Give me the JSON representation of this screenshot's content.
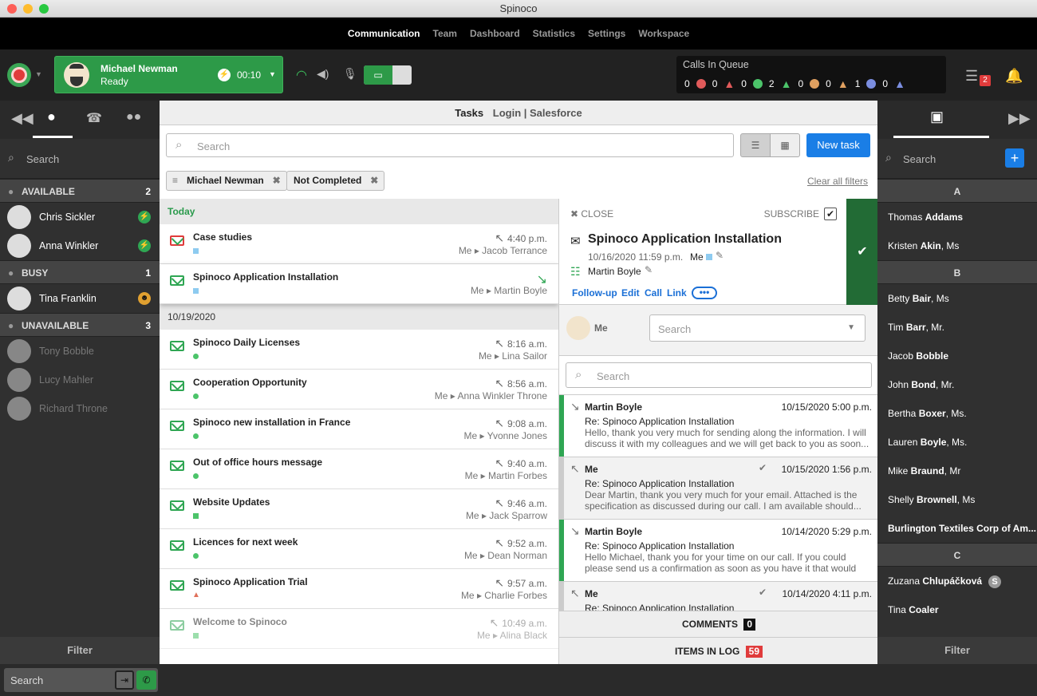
{
  "window": {
    "title": "Spinoco"
  },
  "nav": {
    "items": [
      "Communication",
      "Team",
      "Dashboard",
      "Statistics",
      "Settings",
      "Workspace"
    ],
    "active": 0
  },
  "agent": {
    "name": "Michael Newman",
    "status": "Ready",
    "timer": "00:10"
  },
  "queue": {
    "title": "Calls In Queue",
    "counts": [
      "0",
      "0",
      "0",
      "2",
      "0",
      "0",
      "1",
      "0"
    ]
  },
  "notifications": {
    "task_count": "2"
  },
  "left": {
    "search": "Search",
    "groups": [
      {
        "label": "AVAILABLE",
        "count": "2",
        "people": [
          "Chris Sickler",
          "Anna Winkler"
        ]
      },
      {
        "label": "BUSY",
        "count": "1",
        "people": [
          "Tina Franklin"
        ]
      },
      {
        "label": "UNAVAILABLE",
        "count": "3",
        "people": [
          "Tony Bobble",
          "Lucy Mahler",
          "Richard Throne"
        ]
      }
    ],
    "filter": "Filter"
  },
  "center": {
    "header_title": "Tasks",
    "header_link": "Login | Salesforce",
    "search_placeholder": "Search",
    "new_task": "New task",
    "filter_chip_1": "Michael Newman",
    "filter_chip_2": "Not Completed",
    "clear_filters": "Clear all filters"
  },
  "tasks": {
    "today_label": "Today",
    "today": [
      {
        "title": "Case studies",
        "time": "4:40 p.m.",
        "who": "Me ▸ Jacob Terrance"
      },
      {
        "title": "Spinoco Application Installation",
        "time": "",
        "who": "Me ▸ Martin Boyle"
      }
    ],
    "date_label": "10/19/2020",
    "older": [
      {
        "title": "Spinoco Daily Licenses",
        "time": "8:16 a.m.",
        "who": "Me ▸ Lina Sailor"
      },
      {
        "title": "Cooperation Opportunity",
        "time": "8:56 a.m.",
        "who": "Me ▸ Anna Winkler Throne"
      },
      {
        "title": "Spinoco new installation in France",
        "time": "9:08 a.m.",
        "who": "Me ▸ Yvonne Jones"
      },
      {
        "title": "Out of office hours message",
        "time": "9:40 a.m.",
        "who": "Me ▸ Martin Forbes"
      },
      {
        "title": "Website Updates",
        "time": "9:46 a.m.",
        "who": "Me ▸ Jack Sparrow"
      },
      {
        "title": "Licences for next week",
        "time": "9:52 a.m.",
        "who": "Me ▸ Dean Norman"
      },
      {
        "title": "Spinoco Application Trial",
        "time": "9:57 a.m.",
        "who": "Me ▸ Charlie Forbes"
      },
      {
        "title": "Welcome to Spinoco",
        "time": "10:49 a.m.",
        "who": "Me ▸ Alina Black"
      }
    ]
  },
  "detail": {
    "close": "CLOSE",
    "subscribe": "SUBSCRIBE",
    "title": "Spinoco Application Installation",
    "date": "10/16/2020 11:59 p.m.",
    "owner": "Me",
    "contact": "Martin Boyle",
    "actions": [
      "Follow-up",
      "Edit",
      "Call",
      "Link"
    ],
    "assignee": "Me",
    "assign_placeholder": "Search",
    "search_placeholder": "Search",
    "messages": [
      {
        "who": "Martin Boyle",
        "date": "10/15/2020 5:00 p.m.",
        "subject": "Re: Spinoco Application Installation",
        "body": "Hello, thank you very much for sending along the information. I will discuss it with my colleagues and we will get back to you as soon..."
      },
      {
        "who": "Me",
        "date": "10/15/2020 1:56 p.m.",
        "subject": "Re: Spinoco Application Installation",
        "body": "Dear Martin, thank you very much for your email. Attached is the specification as discussed during our call. I am available should..."
      },
      {
        "who": "Martin Boyle",
        "date": "10/14/2020 5:29 p.m.",
        "subject": "Re: Spinoco Application Installation",
        "body": "Hello Michael, thank you for your time on our call. If you could please send us a confirmation as soon as you have it that would b..."
      },
      {
        "who": "Me",
        "date": "10/14/2020 4:11 p.m.",
        "subject": "Re: Spinoco Application Installation",
        "body": ""
      }
    ],
    "comments_label": "COMMENTS",
    "comments_count": "0",
    "log_label": "ITEMS IN LOG",
    "log_count": "59"
  },
  "right": {
    "search": "Search",
    "sections": [
      {
        "letter": "A",
        "contacts": [
          [
            "Thomas ",
            "Addams",
            ""
          ],
          [
            "Kristen ",
            "Akin",
            ", Ms"
          ]
        ]
      },
      {
        "letter": "B",
        "contacts": [
          [
            "Betty ",
            "Bair",
            ", Ms"
          ],
          [
            "Tim ",
            "Barr",
            ", Mr."
          ],
          [
            "Jacob ",
            "Bobble",
            ""
          ],
          [
            "John ",
            "Bond",
            ", Mr."
          ],
          [
            "Bertha ",
            "Boxer",
            ", Ms."
          ],
          [
            "Lauren ",
            "Boyle",
            ", Ms."
          ],
          [
            "Mike ",
            "Braund",
            ", Mr"
          ],
          [
            "Shelly ",
            "Brownell",
            ", Ms"
          ],
          [
            "",
            "Burlington Textiles Corp of Am...",
            ""
          ]
        ]
      },
      {
        "letter": "C",
        "contacts": [
          [
            "Zuzana ",
            "Chlupáčková",
            ""
          ],
          [
            "Tina ",
            "Coaler",
            ""
          ]
        ]
      }
    ],
    "filter": "Filter"
  },
  "bottom": {
    "search": "Search"
  }
}
